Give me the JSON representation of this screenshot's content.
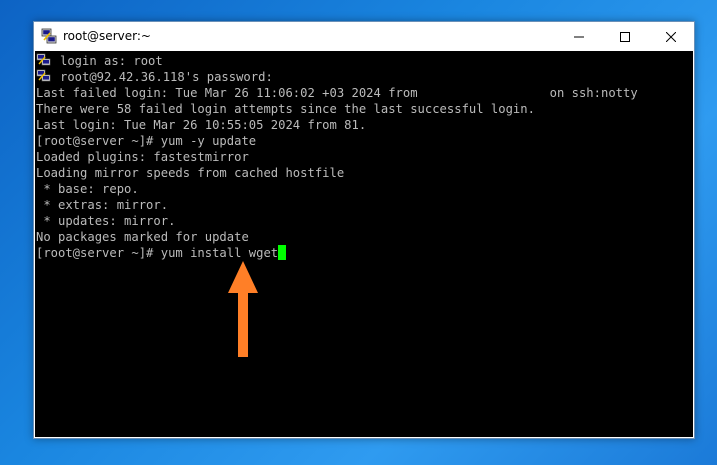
{
  "window": {
    "title": "root@server:~",
    "controls": {
      "minimize_glyph": "—",
      "maximize_glyph": "☐",
      "close_glyph": "✕"
    }
  },
  "terminal": {
    "lines": [
      {
        "icon": "putty-key-icon",
        "text": "login as: root"
      },
      {
        "icon": "putty-key-icon",
        "text": "root@92.42.36.118's password:"
      },
      {
        "text": "Last failed login: Tue Mar 26 11:06:02 +03 2024 from                  on ssh:notty"
      },
      {
        "text": "There were 58 failed login attempts since the last successful login."
      },
      {
        "text": "Last login: Tue Mar 26 10:55:05 2024 from 81."
      },
      {
        "text": "[root@server ~]# yum -y update"
      },
      {
        "text": "Loaded plugins: fastestmirror"
      },
      {
        "text": "Loading mirror speeds from cached hostfile"
      },
      {
        "text": " * base: repo."
      },
      {
        "text": " * extras: mirror."
      },
      {
        "text": " * updates: mirror."
      },
      {
        "text": "No packages marked for update"
      },
      {
        "text": "[root@server ~]# yum install wget",
        "cursor": true
      }
    ],
    "cursor_color": "#00ff00",
    "foreground_color": "#bbbbbb",
    "background_color": "#000000"
  },
  "annotation": {
    "arrow_color": "#ff7f27",
    "arrow_direction": "up"
  },
  "colors": {
    "desktop": "#1a7fd4",
    "titlebar": "#ffffff"
  }
}
